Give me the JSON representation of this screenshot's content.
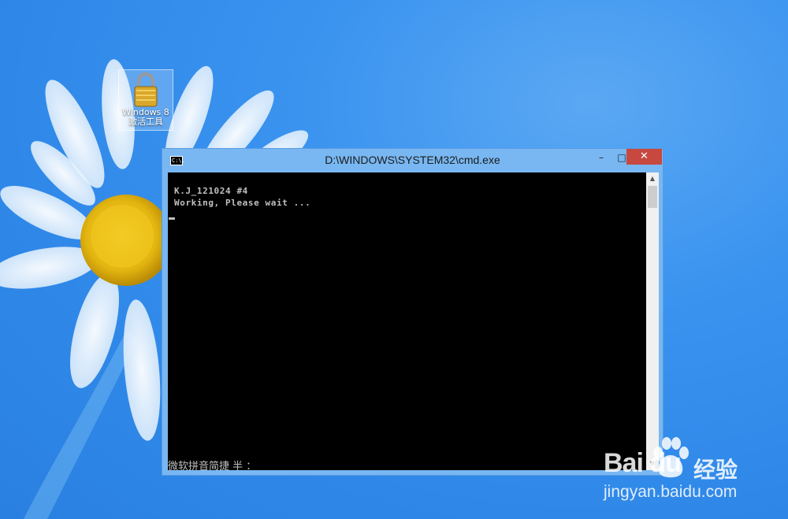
{
  "desktop": {
    "icon_label": "Windows 8\n激活工具",
    "icon": "lock-icon"
  },
  "window": {
    "title": "D:\\WINDOWS\\SYSTEM32\\cmd.exe",
    "app_icon_text": "C:\\.",
    "minimize_symbol": "–",
    "maximize_symbol": "□",
    "close_symbol": "✕"
  },
  "console": {
    "lines": [
      "K.J_121024 #4",
      "Working, Please wait ..."
    ],
    "ime_status": "微软拼音简捷 半 ："
  },
  "watermark": {
    "brand": "Bai du",
    "brand_cn": "经验",
    "url": "jingyan.baidu.com"
  },
  "colors": {
    "desktop_bg": "#3a93ef",
    "window_frame": "#78b7f2",
    "close_button": "#c7483f",
    "console_bg": "#000000",
    "console_text": "#c0c0c0"
  }
}
